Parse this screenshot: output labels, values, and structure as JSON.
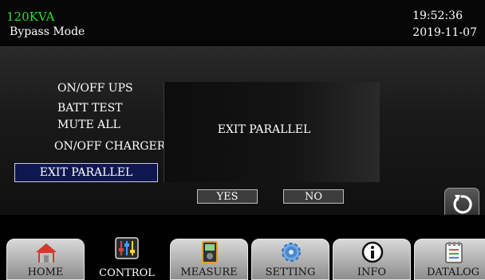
{
  "header": {
    "model": "120KVA",
    "mode": "Bypass Mode",
    "time": "19:52:36",
    "date": "2019-11-07"
  },
  "menu": {
    "items": [
      "ON/OFF UPS",
      "BATT TEST",
      "MUTE ALL",
      "ON/OFF CHARGER",
      "EXIT PARALLEL"
    ],
    "selected_index": 4
  },
  "dialog": {
    "message": "EXIT PARALLEL",
    "yes_label": "YES",
    "no_label": "NO"
  },
  "tabs": [
    {
      "label": "HOME",
      "icon": "home-icon"
    },
    {
      "label": "CONTROL",
      "icon": "sliders-icon",
      "active": true
    },
    {
      "label": "MEASURE",
      "icon": "meter-icon"
    },
    {
      "label": "SETTING",
      "icon": "gear-icon"
    },
    {
      "label": "INFO",
      "icon": "info-icon"
    },
    {
      "label": "DATALOG",
      "icon": "log-icon"
    }
  ],
  "colors": {
    "model_text": "#2fe02f",
    "selected_bg": "#0f1750"
  }
}
